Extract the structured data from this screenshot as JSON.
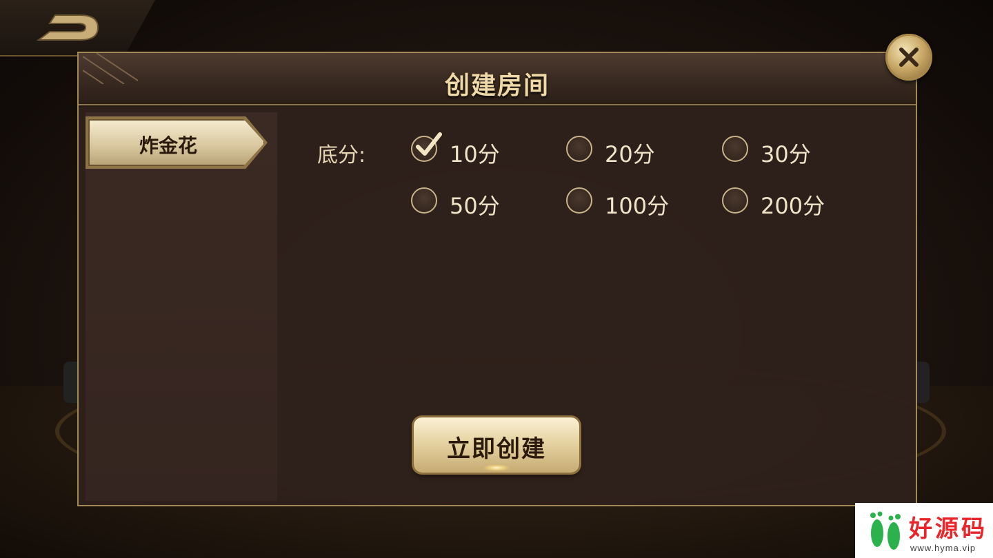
{
  "dialog": {
    "title": "创建房间"
  },
  "sidebar": {
    "selected_game": "炸金花"
  },
  "score": {
    "label": "底分:",
    "options": [
      {
        "label": "10分",
        "checked": true
      },
      {
        "label": "20分",
        "checked": false
      },
      {
        "label": "30分",
        "checked": false
      },
      {
        "label": "50分",
        "checked": false
      },
      {
        "label": "100分",
        "checked": false
      },
      {
        "label": "200分",
        "checked": false
      }
    ]
  },
  "actions": {
    "create_label": "立即创建"
  },
  "watermark": {
    "title": "好源码",
    "url": "www.hyma.vip"
  },
  "icons": {
    "back": "back-arrow-icon",
    "close": "close-icon",
    "check": "checkmark-icon"
  },
  "colors": {
    "accent_gold": "#c9a867",
    "title_text": "#f0d9a8",
    "watermark_red": "#e8262b"
  }
}
